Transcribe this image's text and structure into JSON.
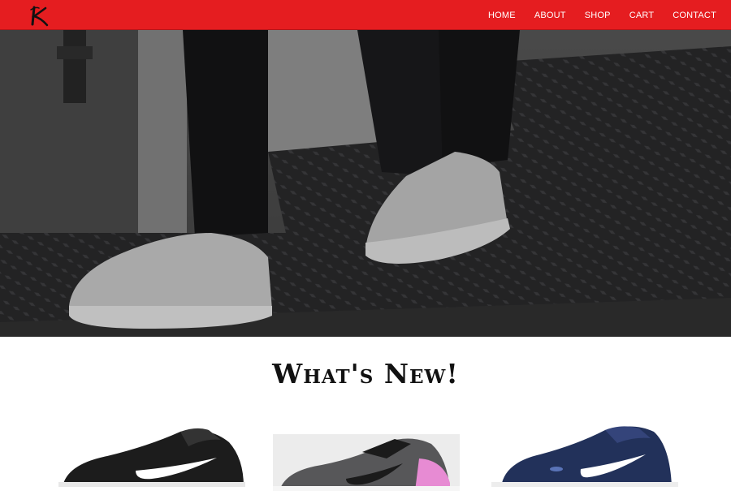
{
  "brand": {
    "logo_letter": "K",
    "color": "#e51d20"
  },
  "nav": {
    "items": [
      {
        "label": "HOME"
      },
      {
        "label": "ABOUT"
      },
      {
        "label": "SHOP"
      },
      {
        "label": "CART"
      },
      {
        "label": "CONTACT"
      }
    ]
  },
  "hero": {
    "image": "white-sneakers-on-metal-stairs"
  },
  "section": {
    "title": "What's New!"
  },
  "products": [
    {
      "image": "black-nike-sneaker",
      "colors": [
        "#1a1a1a",
        "#ffffff"
      ]
    },
    {
      "image": "grey-pink-nike-sneaker",
      "colors": [
        "#5a5a5e",
        "#e78bd3"
      ]
    },
    {
      "image": "navy-nike-sneaker",
      "colors": [
        "#22315a",
        "#ffffff"
      ]
    }
  ]
}
